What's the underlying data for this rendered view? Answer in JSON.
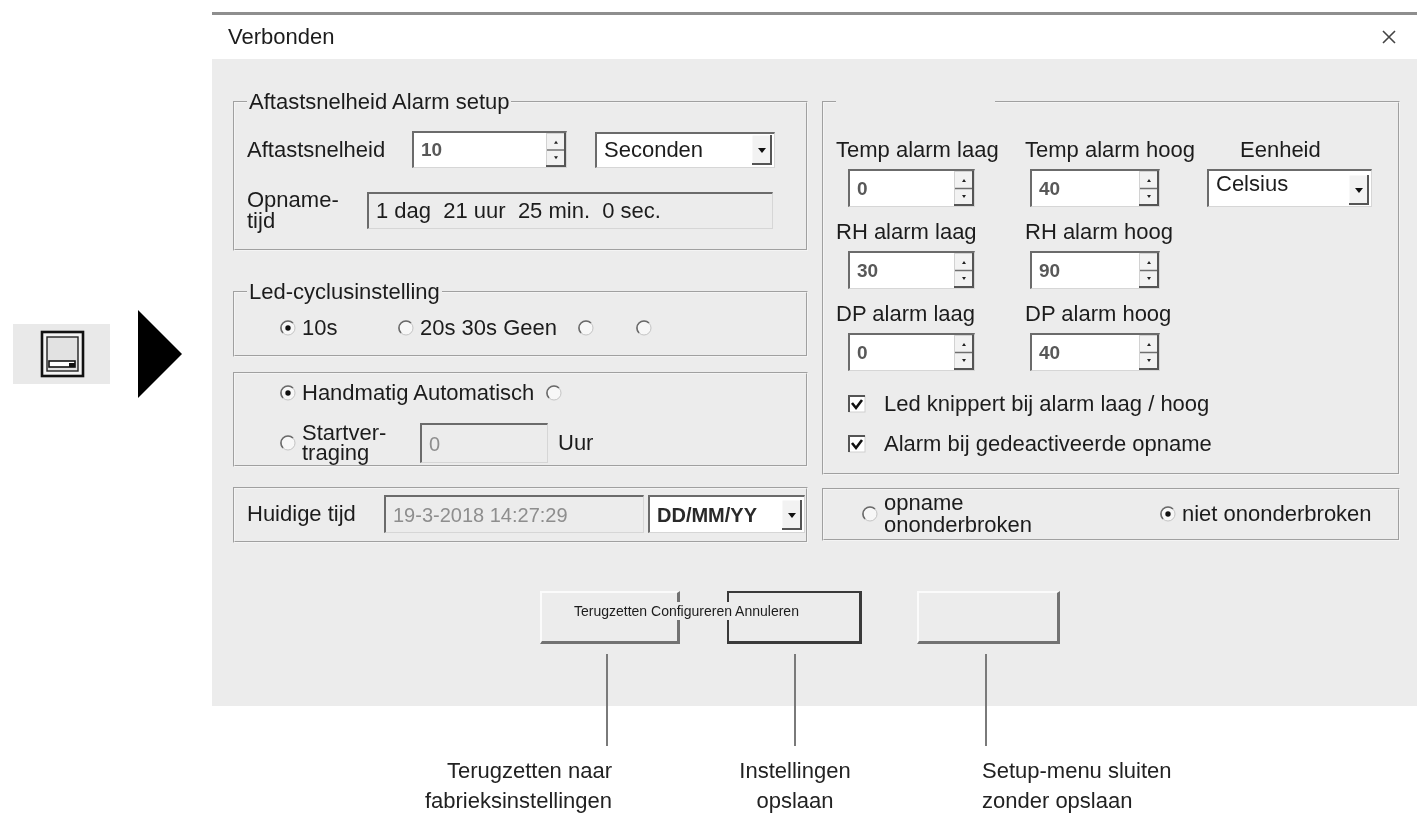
{
  "window": {
    "title": "Verbonden"
  },
  "sampling": {
    "title": "Aftastsnelheid Alarm setup",
    "rate_label": "Aftastsnelheid",
    "rate_value": "10",
    "unit": "Seconden",
    "duration_label": "Opname-tijd",
    "duration_value": "1 dag  21 uur  25 min.  0 sec."
  },
  "led_cycle": {
    "title": "Led-cyclusinstelling",
    "options": [
      {
        "label": "10s",
        "selected": true
      },
      {
        "label": "20s 30s Geen",
        "selected": false
      },
      {
        "selected": false
      },
      {
        "selected": false
      }
    ]
  },
  "start_mode": {
    "options": [
      {
        "label": "Handmatig Automatisch",
        "selected": true
      },
      {
        "selected": false
      },
      {
        "label": "Startver-traging",
        "selected": false
      }
    ],
    "delay": {
      "value": "0",
      "disabled": true
    },
    "delay_unit": "Uur"
  },
  "clock": {
    "label": "Huidige tijd",
    "value": "19-3-2018 14:27:29",
    "disabled": true,
    "format": "DD/MM/YY"
  },
  "alarms": {
    "fields": [
      {
        "label": "Temp alarm laag",
        "value": "0"
      },
      {
        "label": "Temp alarm hoog",
        "value": "40"
      },
      {
        "label": "RH alarm laag",
        "value": "30"
      },
      {
        "label": "RH alarm hoog",
        "value": "90"
      },
      {
        "label": "DP alarm laag",
        "value": "0"
      },
      {
        "label": "DP alarm hoog",
        "value": "40"
      }
    ],
    "unit_label": "Eenheid",
    "unit": "Celsius",
    "checkboxes": [
      {
        "label": "Led knippert bij alarm laag / hoog",
        "checked": true
      },
      {
        "label": "Alarm bij gedeactiveerde opname",
        "checked": true
      }
    ]
  },
  "recording": {
    "options": [
      {
        "label": "opname ononderbroken",
        "selected": false
      },
      {
        "label": "niet ononderbroken",
        "selected": true
      }
    ]
  },
  "buttons": {
    "caption": "Terugzetten Configureren Annuleren",
    "items": [
      {
        "default": false
      },
      {
        "default": true
      },
      {
        "default": false
      }
    ]
  },
  "callouts": [
    {
      "text": "Terugzetten naar fabrieksinstellingen"
    },
    {
      "text": "Instellingen opslaan"
    },
    {
      "text": "Setup-menu sluiten zonder opslaan"
    }
  ]
}
